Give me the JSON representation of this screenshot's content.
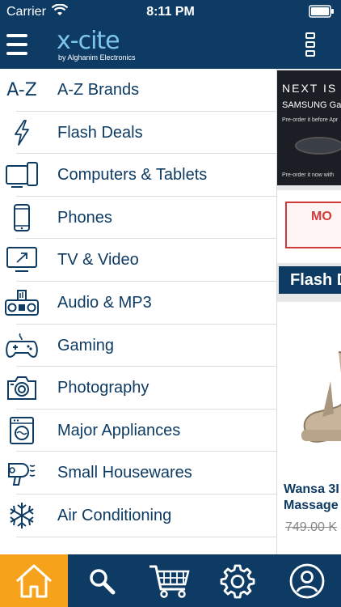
{
  "status": {
    "carrier": "Carrier",
    "time": "8:11 PM"
  },
  "header": {
    "logo_word": "x-cite",
    "logo_sub": "by Alghanim Electronics"
  },
  "menu": {
    "items": [
      {
        "label": "A-Z Brands",
        "icon": "az-icon",
        "glyph": "A-Z"
      },
      {
        "label": "Flash Deals",
        "icon": "lightning-icon"
      },
      {
        "label": "Computers & Tablets",
        "icon": "computer-tablet-icon"
      },
      {
        "label": "Phones",
        "icon": "phone-icon"
      },
      {
        "label": "TV & Video",
        "icon": "tv-icon"
      },
      {
        "label": "Audio & MP3",
        "icon": "boombox-icon"
      },
      {
        "label": "Gaming",
        "icon": "gamepad-icon"
      },
      {
        "label": "Photography",
        "icon": "camera-icon"
      },
      {
        "label": "Major Appliances",
        "icon": "washing-machine-icon"
      },
      {
        "label": "Small Housewares",
        "icon": "hair-dryer-icon"
      },
      {
        "label": "Air Conditioning",
        "icon": "snowflake-icon"
      }
    ]
  },
  "peek": {
    "banner_next": "NEXT IS",
    "banner_brand": "SAMSUNG Galax",
    "banner_preorder": "Pre-order it before Apr",
    "banner_preorder2": "Pre-order it now with",
    "promo_text": "MO",
    "flash_label": "Flash D",
    "product_name_1": "Wansa 3I",
    "product_name_2": "Massage",
    "product_price": "749.00 K"
  },
  "tabs": [
    {
      "name": "home",
      "icon": "home-icon",
      "active": true
    },
    {
      "name": "search",
      "icon": "search-icon",
      "active": false
    },
    {
      "name": "cart",
      "icon": "cart-icon",
      "active": false
    },
    {
      "name": "settings",
      "icon": "gear-icon",
      "active": false
    },
    {
      "name": "account",
      "icon": "user-icon",
      "active": false
    }
  ],
  "colors": {
    "navy": "#0e3b63",
    "accent": "#f7a21b",
    "logo": "#7fc6ee"
  }
}
